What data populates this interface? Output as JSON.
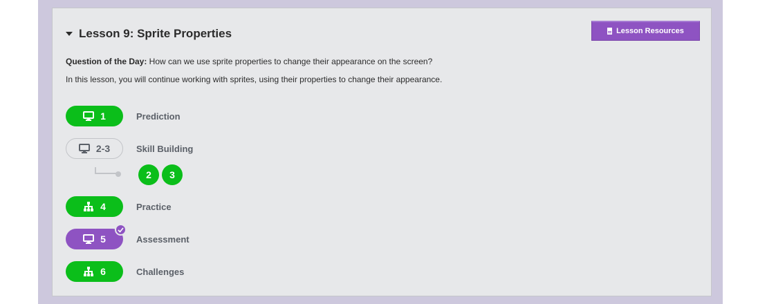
{
  "lesson": {
    "title": "Lesson 9: Sprite Properties",
    "resources_label": "Lesson Resources",
    "qotd_label": "Question of the Day:",
    "qotd_text": " How can we use sprite properties to change their appearance on the screen?",
    "description": "In this lesson, you will continue working with sprites, using their properties to change their appearance."
  },
  "levels": [
    {
      "number": "1",
      "label": "Prediction",
      "icon": "monitor-icon",
      "status": "completed"
    },
    {
      "number": "2-3",
      "label": "Skill Building",
      "icon": "monitor-icon",
      "status": "group"
    },
    {
      "number": "4",
      "label": "Practice",
      "icon": "network-icon",
      "status": "completed"
    },
    {
      "number": "5",
      "label": "Assessment",
      "icon": "monitor-icon",
      "status": "submitted"
    },
    {
      "number": "6",
      "label": "Challenges",
      "icon": "network-icon",
      "status": "completed"
    }
  ],
  "sublevels": [
    "2",
    "3"
  ],
  "colors": {
    "completed": "#0bbe1a",
    "submitted": "#8e53c2",
    "background": "#cdc8dd",
    "card": "#e7e8ea"
  }
}
